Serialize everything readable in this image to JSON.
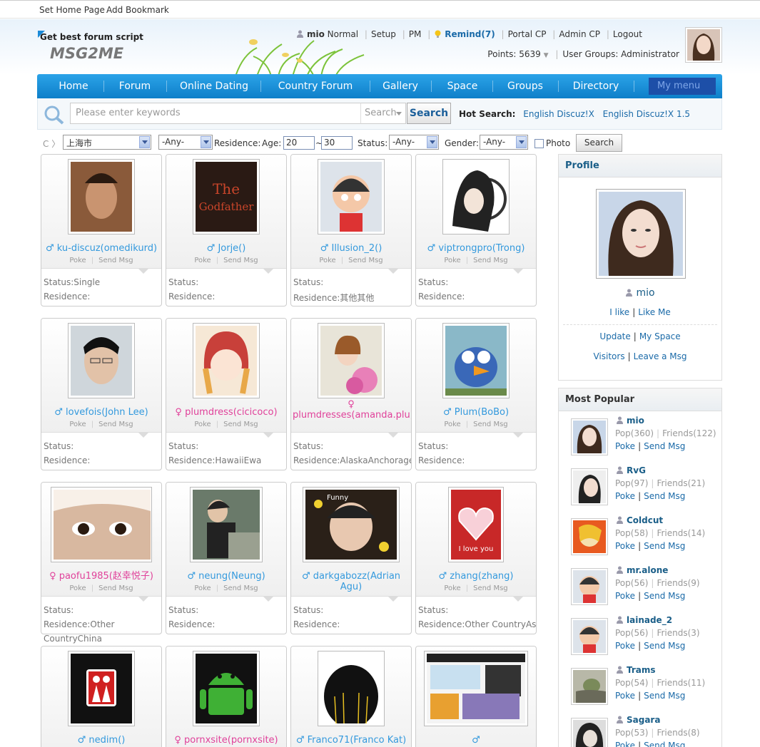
{
  "topbar": {
    "set_home": "Set Home Page",
    "add_bookmark": "Add Bookmark"
  },
  "header": {
    "tagline": "Get best forum script",
    "logo": "MSG2ME",
    "username": "mio",
    "level": "Normal",
    "links": [
      "Setup",
      "PM"
    ],
    "remind": "Remind(7)",
    "links2": [
      "Portal CP",
      "Admin CP",
      "Logout"
    ],
    "points": "Points: 5639",
    "user_groups": "User Groups: Administrator"
  },
  "nav": {
    "items": [
      "Home",
      "Forum",
      "Online Dating",
      "Country Forum",
      "Gallery",
      "Space",
      "Groups",
      "Directory"
    ],
    "my_menu": "My menu"
  },
  "search": {
    "placeholder": "Please enter keywords",
    "type": "Search",
    "button": "Search",
    "hot_label": "Hot Search:",
    "hot_links": [
      "English Discuz!X",
      "English Discuz!X 1.5"
    ]
  },
  "filter": {
    "city": "上海市",
    "any1": "-Any-",
    "residence_label": "Residence:",
    "age_label": "Age:",
    "age_from": "20",
    "tilde": "~",
    "age_to": "30",
    "status_label": "Status:",
    "status_value": "-Any-",
    "gender_label": "Gender:",
    "gender_value": "-Any-",
    "photo_label": "Photo",
    "search_button": "Search"
  },
  "card_labels": {
    "poke": "Poke",
    "send_msg": "Send Msg",
    "status": "Status:",
    "residence": "Residence:"
  },
  "cards": [
    {
      "sym": "♂",
      "name": "ku-discuz(omedikurd)",
      "status": "Status:Single",
      "residence": "Residence:"
    },
    {
      "sym": "♂",
      "name": "Jorje()",
      "status": "Status:",
      "residence": "Residence:"
    },
    {
      "sym": "♂",
      "name": "Illusion_2()",
      "status": "Status:",
      "residence": "Residence:其他其他"
    },
    {
      "sym": "♂",
      "name": "viptrongpro(Trong)",
      "status": "Status:",
      "residence": "Residence:"
    },
    {
      "sym": "♂",
      "name": "lovefois(John Lee)",
      "status": "Status:",
      "residence": "Residence:"
    },
    {
      "sym": "♀",
      "name": "plumdress(cicicoco)",
      "status": "Status:",
      "residence": "Residence:HawaiiEwa"
    },
    {
      "sym": "♀",
      "name": "plumdresses(amanda.plu)",
      "status": "Status:",
      "residence": "Residence:AlaskaAnchorage"
    },
    {
      "sym": "♂",
      "name": "Plum(BoBo)",
      "status": "Status:",
      "residence": "Residence:"
    },
    {
      "sym": "♀",
      "name": "paofu1985(赵幸悦子)",
      "status": "Status:",
      "residence": "Residence:Other"
    },
    {
      "sym": "♂",
      "name": "neung(Neung)",
      "status": "Status:",
      "residence": "Residence:"
    },
    {
      "sym": "♂",
      "name": "darkgabozz(Adrian Agu)",
      "status": "Status:",
      "residence": "Residence:"
    },
    {
      "sym": "♂",
      "name": "zhang(zhang)",
      "status": "Status:",
      "residence": "Residence:Other CountryAsia"
    },
    {
      "sym": "♂",
      "name": "nedim()",
      "status": "",
      "residence": ""
    },
    {
      "sym": "♀",
      "name": "pornxsite(pornxsite)",
      "status": "",
      "residence": ""
    },
    {
      "sym": "♂",
      "name": "Franco71(Franco Kat)",
      "status": "",
      "residence": ""
    },
    {
      "sym": "♂",
      "name": "",
      "status": "",
      "residence": ""
    }
  ],
  "overflow_text": "CountryChina",
  "profile": {
    "title": "Profile",
    "name": "mio",
    "i_like": "I like",
    "like_me": "Like Me",
    "update": "Update",
    "my_space": "My Space",
    "visitors": "Visitors",
    "leave_msg": "Leave a Msg"
  },
  "popular": {
    "title": "Most Popular",
    "poke": "Poke",
    "send_msg": "Send Msg",
    "users": [
      {
        "name": "mio",
        "pop": "Pop(360)",
        "friends": "Friends(122)"
      },
      {
        "name": "RvG",
        "pop": "Pop(97)",
        "friends": "Friends(21)"
      },
      {
        "name": "Coldcut",
        "pop": "Pop(58)",
        "friends": "Friends(14)"
      },
      {
        "name": "mr.alone",
        "pop": "Pop(56)",
        "friends": "Friends(9)"
      },
      {
        "name": "lainade_2",
        "pop": "Pop(56)",
        "friends": "Friends(3)"
      },
      {
        "name": "Trams",
        "pop": "Pop(54)",
        "friends": "Friends(11)"
      },
      {
        "name": "Sagara",
        "pop": "Pop(53)",
        "friends": "Friends(8)"
      }
    ]
  },
  "colors": {
    "nav": "#0e7fc9",
    "male": "#3399dd",
    "female": "#e0419a",
    "link": "#1a6aa8"
  }
}
